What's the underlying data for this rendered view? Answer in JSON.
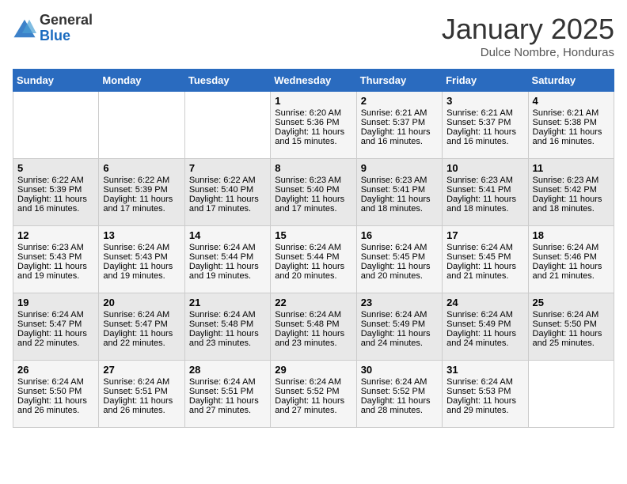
{
  "logo": {
    "general": "General",
    "blue": "Blue"
  },
  "title": "January 2025",
  "subtitle": "Dulce Nombre, Honduras",
  "days_of_week": [
    "Sunday",
    "Monday",
    "Tuesday",
    "Wednesday",
    "Thursday",
    "Friday",
    "Saturday"
  ],
  "weeks": [
    [
      {
        "day": "",
        "info": ""
      },
      {
        "day": "",
        "info": ""
      },
      {
        "day": "",
        "info": ""
      },
      {
        "day": "1",
        "info": "Sunrise: 6:20 AM\nSunset: 5:36 PM\nDaylight: 11 hours and 15 minutes."
      },
      {
        "day": "2",
        "info": "Sunrise: 6:21 AM\nSunset: 5:37 PM\nDaylight: 11 hours and 16 minutes."
      },
      {
        "day": "3",
        "info": "Sunrise: 6:21 AM\nSunset: 5:37 PM\nDaylight: 11 hours and 16 minutes."
      },
      {
        "day": "4",
        "info": "Sunrise: 6:21 AM\nSunset: 5:38 PM\nDaylight: 11 hours and 16 minutes."
      }
    ],
    [
      {
        "day": "5",
        "info": "Sunrise: 6:22 AM\nSunset: 5:39 PM\nDaylight: 11 hours and 16 minutes."
      },
      {
        "day": "6",
        "info": "Sunrise: 6:22 AM\nSunset: 5:39 PM\nDaylight: 11 hours and 17 minutes."
      },
      {
        "day": "7",
        "info": "Sunrise: 6:22 AM\nSunset: 5:40 PM\nDaylight: 11 hours and 17 minutes."
      },
      {
        "day": "8",
        "info": "Sunrise: 6:23 AM\nSunset: 5:40 PM\nDaylight: 11 hours and 17 minutes."
      },
      {
        "day": "9",
        "info": "Sunrise: 6:23 AM\nSunset: 5:41 PM\nDaylight: 11 hours and 18 minutes."
      },
      {
        "day": "10",
        "info": "Sunrise: 6:23 AM\nSunset: 5:41 PM\nDaylight: 11 hours and 18 minutes."
      },
      {
        "day": "11",
        "info": "Sunrise: 6:23 AM\nSunset: 5:42 PM\nDaylight: 11 hours and 18 minutes."
      }
    ],
    [
      {
        "day": "12",
        "info": "Sunrise: 6:23 AM\nSunset: 5:43 PM\nDaylight: 11 hours and 19 minutes."
      },
      {
        "day": "13",
        "info": "Sunrise: 6:24 AM\nSunset: 5:43 PM\nDaylight: 11 hours and 19 minutes."
      },
      {
        "day": "14",
        "info": "Sunrise: 6:24 AM\nSunset: 5:44 PM\nDaylight: 11 hours and 19 minutes."
      },
      {
        "day": "15",
        "info": "Sunrise: 6:24 AM\nSunset: 5:44 PM\nDaylight: 11 hours and 20 minutes."
      },
      {
        "day": "16",
        "info": "Sunrise: 6:24 AM\nSunset: 5:45 PM\nDaylight: 11 hours and 20 minutes."
      },
      {
        "day": "17",
        "info": "Sunrise: 6:24 AM\nSunset: 5:45 PM\nDaylight: 11 hours and 21 minutes."
      },
      {
        "day": "18",
        "info": "Sunrise: 6:24 AM\nSunset: 5:46 PM\nDaylight: 11 hours and 21 minutes."
      }
    ],
    [
      {
        "day": "19",
        "info": "Sunrise: 6:24 AM\nSunset: 5:47 PM\nDaylight: 11 hours and 22 minutes."
      },
      {
        "day": "20",
        "info": "Sunrise: 6:24 AM\nSunset: 5:47 PM\nDaylight: 11 hours and 22 minutes."
      },
      {
        "day": "21",
        "info": "Sunrise: 6:24 AM\nSunset: 5:48 PM\nDaylight: 11 hours and 23 minutes."
      },
      {
        "day": "22",
        "info": "Sunrise: 6:24 AM\nSunset: 5:48 PM\nDaylight: 11 hours and 23 minutes."
      },
      {
        "day": "23",
        "info": "Sunrise: 6:24 AM\nSunset: 5:49 PM\nDaylight: 11 hours and 24 minutes."
      },
      {
        "day": "24",
        "info": "Sunrise: 6:24 AM\nSunset: 5:49 PM\nDaylight: 11 hours and 24 minutes."
      },
      {
        "day": "25",
        "info": "Sunrise: 6:24 AM\nSunset: 5:50 PM\nDaylight: 11 hours and 25 minutes."
      }
    ],
    [
      {
        "day": "26",
        "info": "Sunrise: 6:24 AM\nSunset: 5:50 PM\nDaylight: 11 hours and 26 minutes."
      },
      {
        "day": "27",
        "info": "Sunrise: 6:24 AM\nSunset: 5:51 PM\nDaylight: 11 hours and 26 minutes."
      },
      {
        "day": "28",
        "info": "Sunrise: 6:24 AM\nSunset: 5:51 PM\nDaylight: 11 hours and 27 minutes."
      },
      {
        "day": "29",
        "info": "Sunrise: 6:24 AM\nSunset: 5:52 PM\nDaylight: 11 hours and 27 minutes."
      },
      {
        "day": "30",
        "info": "Sunrise: 6:24 AM\nSunset: 5:52 PM\nDaylight: 11 hours and 28 minutes."
      },
      {
        "day": "31",
        "info": "Sunrise: 6:24 AM\nSunset: 5:53 PM\nDaylight: 11 hours and 29 minutes."
      },
      {
        "day": "",
        "info": ""
      }
    ]
  ]
}
